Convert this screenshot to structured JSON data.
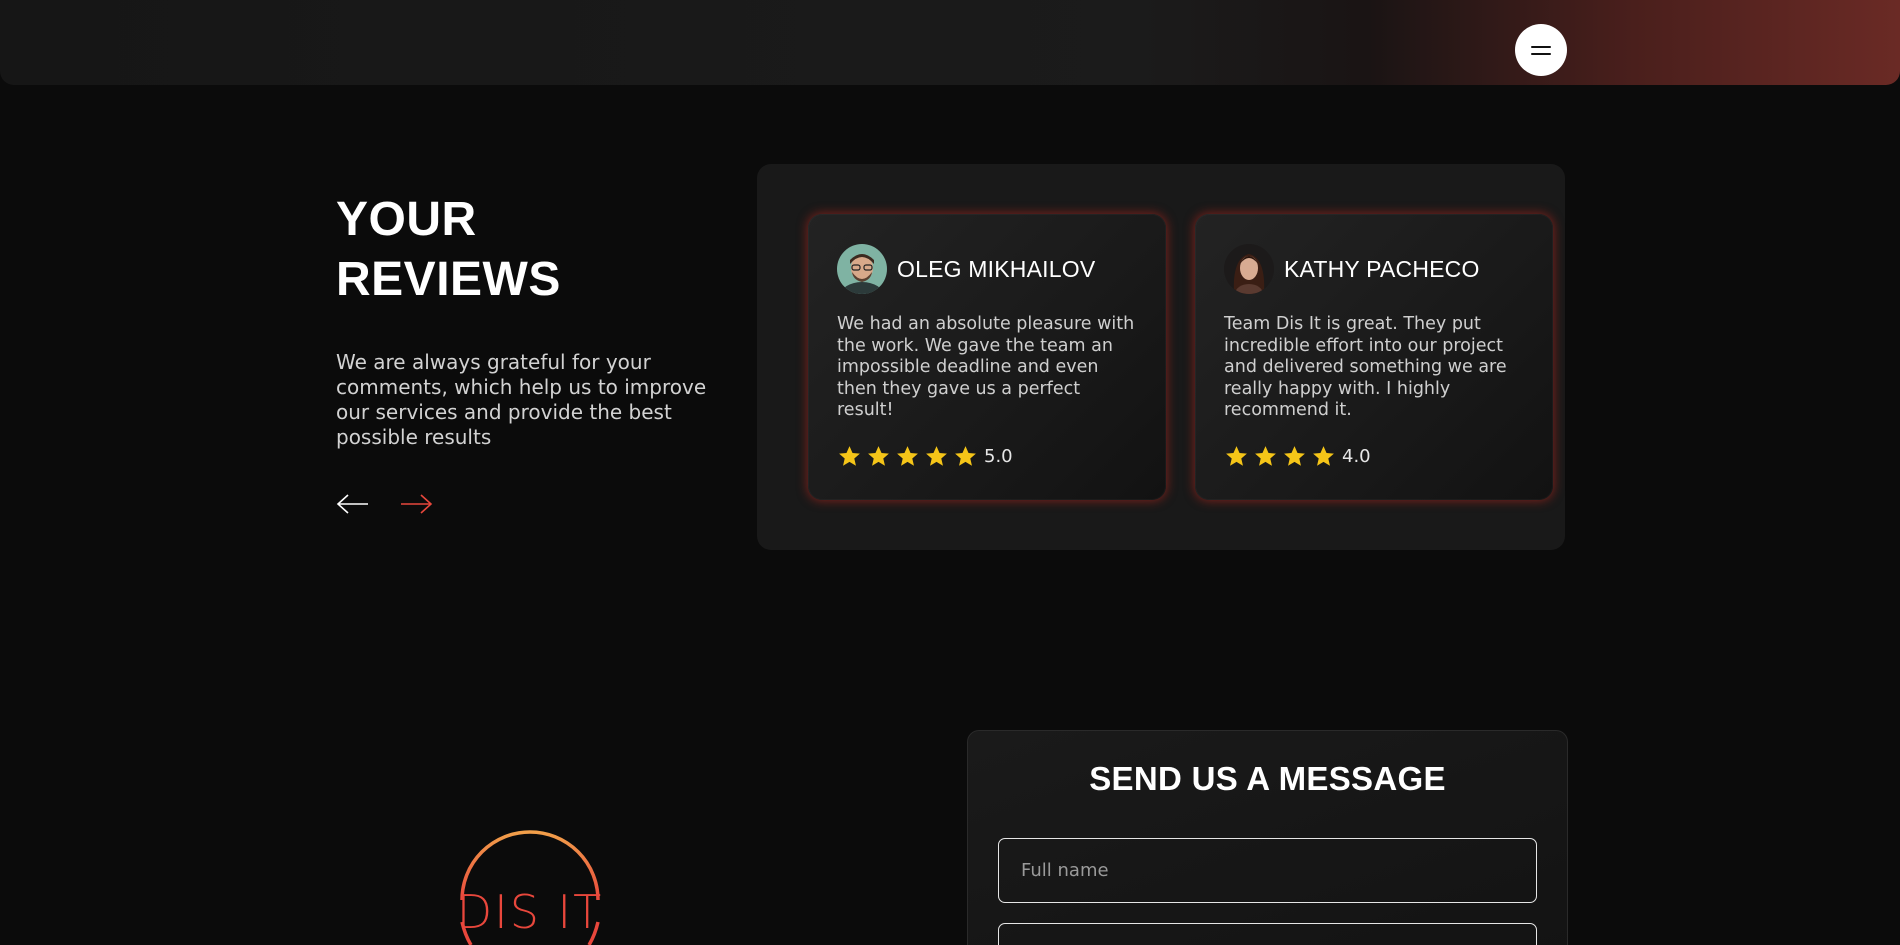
{
  "header": {
    "menu_icon": "hamburger-menu-icon"
  },
  "reviews": {
    "title_line1": "YOUR",
    "title_line2": "REVIEWS",
    "description": "We are always grateful for your comments, which help us to improve our services and provide the best possible results",
    "prev_icon": "arrow-left-icon",
    "next_icon": "arrow-right-icon",
    "accent": "#e8473c",
    "star_color": "#f5c518",
    "items": [
      {
        "name": "OLEG MIKHAILOV",
        "text": "We had an absolute pleasure with the work. We gave the team an impossible deadline and even then they gave us a perfect result!",
        "rating": "5.0",
        "rating_value": 5
      },
      {
        "name": "KATHY PACHECO",
        "text": "Team Dis It is great. They put incredible effort into our project and delivered something we are really happy with. I highly recommend it.",
        "rating": "4.0",
        "rating_value": 4
      }
    ]
  },
  "logo": {
    "text": "DIS IT"
  },
  "contact": {
    "title": "SEND US A MESSAGE",
    "full_name_placeholder": "Full name",
    "second_placeholder": ""
  }
}
